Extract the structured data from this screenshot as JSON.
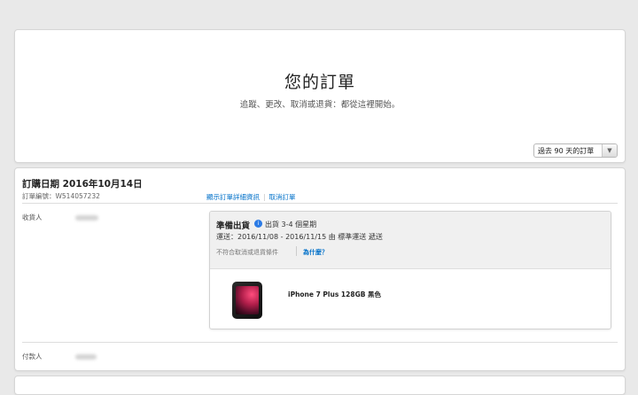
{
  "hero": {
    "title": "您的訂單",
    "subtitle": "追蹤、更改、取消或退貨：都從這裡開始。",
    "filter_value": "過去 90 天的訂單"
  },
  "order": {
    "date_label": "訂購日期 2016年10月14日",
    "number_label": "訂單編號：W514057232",
    "link_details": "顯示訂單詳細資訊",
    "link_cancel": "取消訂單",
    "recipient_label": "收貨人",
    "payer_label": "付款人",
    "shipment": {
      "status": "準備出貨",
      "eta": "出貨 3-4 個星期",
      "delivery": "運送：2016/11/08 - 2016/11/15 由 標準運送 遞送",
      "policy": "不符合取消或退貨條件",
      "why_link": "為什麼？",
      "product_name": "iPhone 7 Plus 128GB 黑色"
    }
  },
  "icons": {
    "info": "info-icon",
    "dropdown": "chevron-down-icon",
    "product": "iphone-image"
  },
  "colors": {
    "link": "#0070c9",
    "info_icon": "#2c7be5"
  }
}
